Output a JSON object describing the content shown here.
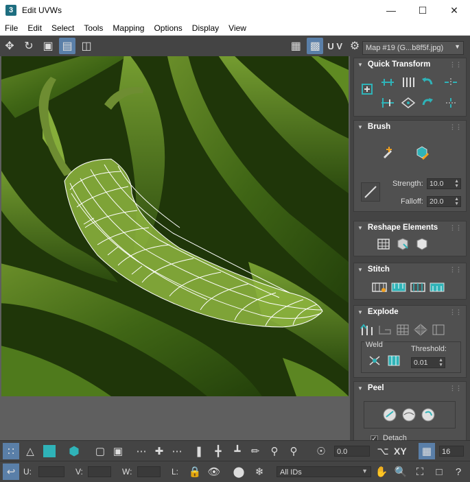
{
  "window": {
    "title": "Edit UVWs",
    "app_badge": "3"
  },
  "menu": [
    "File",
    "Edit",
    "Select",
    "Tools",
    "Mapping",
    "Options",
    "Display",
    "View"
  ],
  "toolbar": {
    "uv_label": "U V",
    "map_select": "Map #19 (G...b8f5f.jpg)"
  },
  "panel": {
    "quick_transform": "Quick Transform",
    "brush": "Brush",
    "strength_label": "Strength:",
    "strength_value": "10.0",
    "falloff_label": "Falloff:",
    "falloff_value": "20.0",
    "reshape": "Reshape Elements",
    "stitch": "Stitch",
    "explode": "Explode",
    "weld_label": "Weld",
    "threshold_label": "Threshold:",
    "threshold_value": "0.01",
    "peel": "Peel",
    "detach_label": "Detach",
    "detach_checked": true
  },
  "bottom": {
    "angle_value": "0.0",
    "xy_label": "XY",
    "count_value": "16",
    "u_label": "U:",
    "v_label": "V:",
    "w_label": "W:",
    "l_label": "L:",
    "ids_select": "All IDs"
  },
  "colors": {
    "accent": "#5a7fa8",
    "teal": "#2fb3b8",
    "bg": "#444444"
  }
}
